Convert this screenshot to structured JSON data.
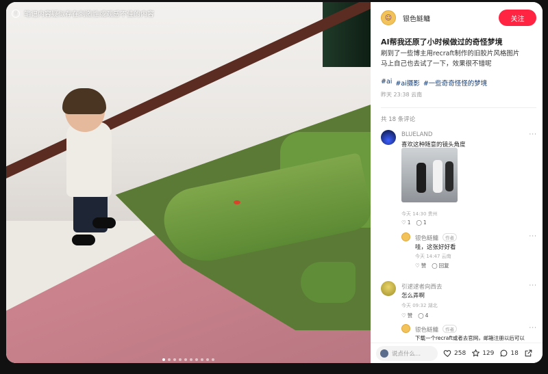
{
  "media": {
    "warning_text": "笔记内容疑似存在刺激性或观感不佳的内容",
    "dots_total": 10,
    "dots_active": 0
  },
  "author": {
    "name": "银色鲢鳙",
    "follow_label": "关注"
  },
  "post": {
    "title": "AI帮我还原了小时候做过的奇怪梦境",
    "body_line1": "刷到了一些博主用recraft制作的旧胶片风格图片",
    "body_line2": "马上自己也去试了一下，效果很不错呢",
    "tags": [
      "#ai",
      "#ai摄影",
      "#一些奇奇怪怪的梦境"
    ],
    "meta": "昨天 23:38 云南"
  },
  "comments_count": "共 18 条评论",
  "comments": [
    {
      "name": "BLUELAND",
      "text": "喜欢这种随意的镜头角度",
      "meta": "今天 14:30 贵州",
      "likes": "1",
      "replies": "1",
      "avatar_color": "#1a2a66"
    },
    {
      "name": "银色鲢鳙",
      "badge": "作者",
      "text": "哇，这张好好看",
      "meta": "今天 14:47 云南",
      "like_label": "赞",
      "reply_label": "回复",
      "avatar_color": "#f2c35b"
    },
    {
      "name": "引逑逑者向西去",
      "text": "怎么弄啊",
      "meta": "今天 09:32 湖北",
      "like_label": "赞",
      "replies": "4",
      "avatar_color": "#c8b73a"
    },
    {
      "name": "银色鲢鳙",
      "badge": "作者",
      "text": "下载一个recraft或者去官网，邮箱注册以后可以",
      "avatar_color": "#f2c35b"
    }
  ],
  "bottom": {
    "input_placeholder": "说点什么...",
    "likes": "258",
    "stars": "129",
    "comments": "18"
  },
  "more_glyph": "···"
}
